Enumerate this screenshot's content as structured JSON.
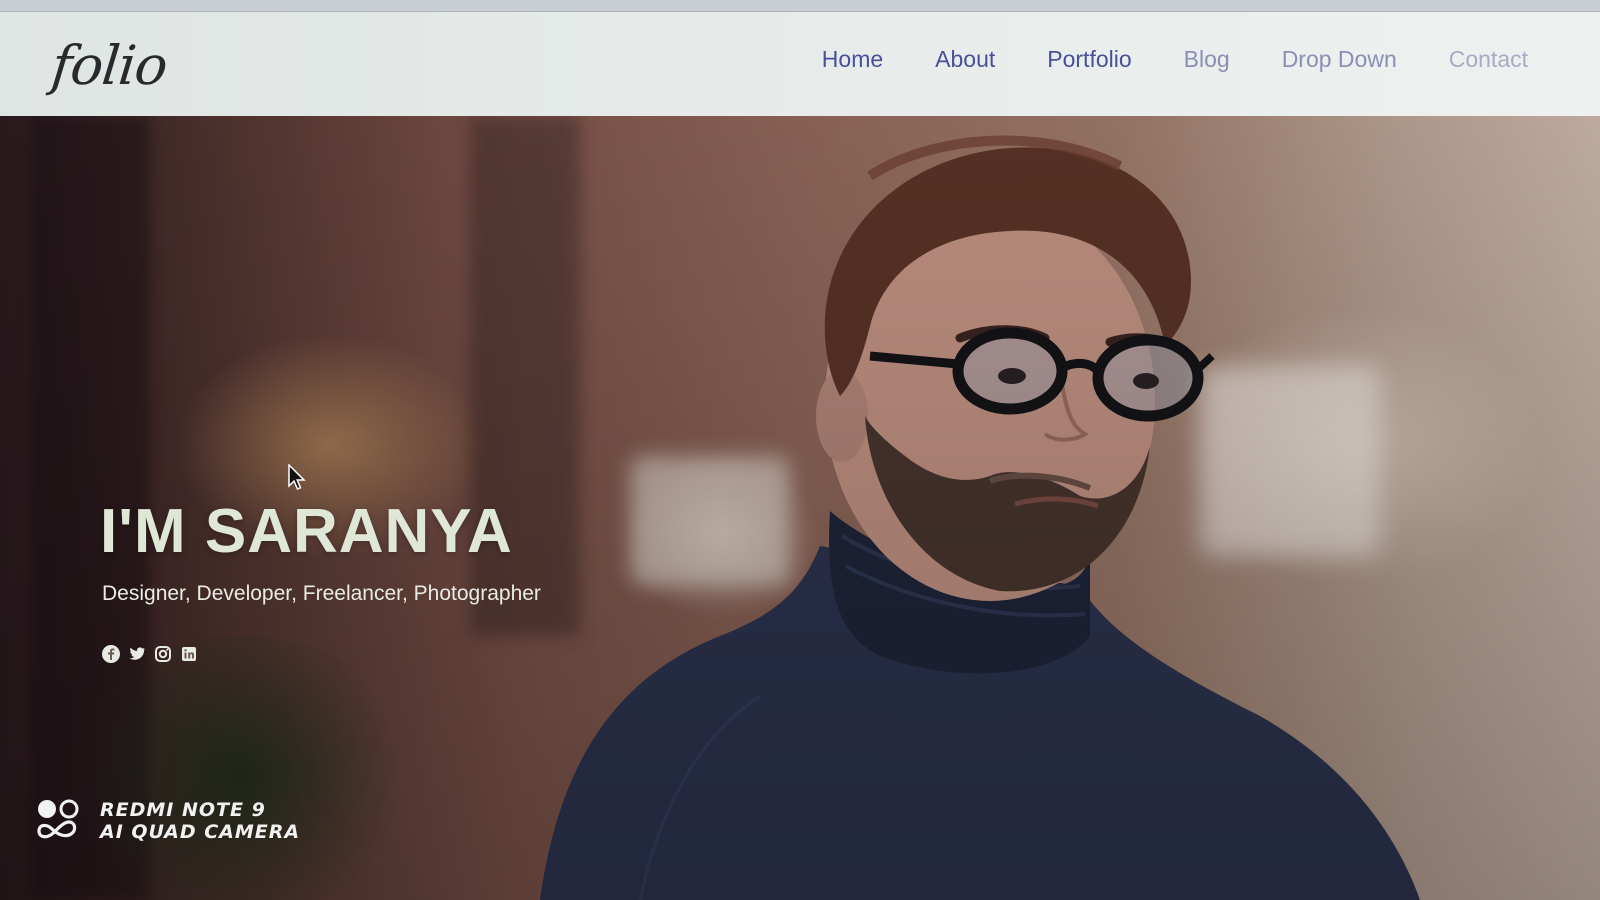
{
  "site": {
    "logo": "folio"
  },
  "nav": {
    "items": [
      {
        "label": "Home"
      },
      {
        "label": "About"
      },
      {
        "label": "Portfolio"
      },
      {
        "label": "Blog"
      },
      {
        "label": "Drop Down"
      },
      {
        "label": "Contact"
      }
    ]
  },
  "hero": {
    "title": "I'M SARANYA",
    "subtitle": "Designer, Developer, Freelancer, Photographer",
    "social_icons": [
      "facebook-icon",
      "twitter-icon",
      "instagram-icon",
      "linkedin-icon"
    ]
  },
  "watermark": {
    "line1": "REDMI NOTE 9",
    "line2": "AI QUAD CAMERA"
  },
  "colors": {
    "nav_link": "#4a4f9a",
    "hero_title": "#dfe7d6",
    "header_bg": "#e6ebe9"
  }
}
